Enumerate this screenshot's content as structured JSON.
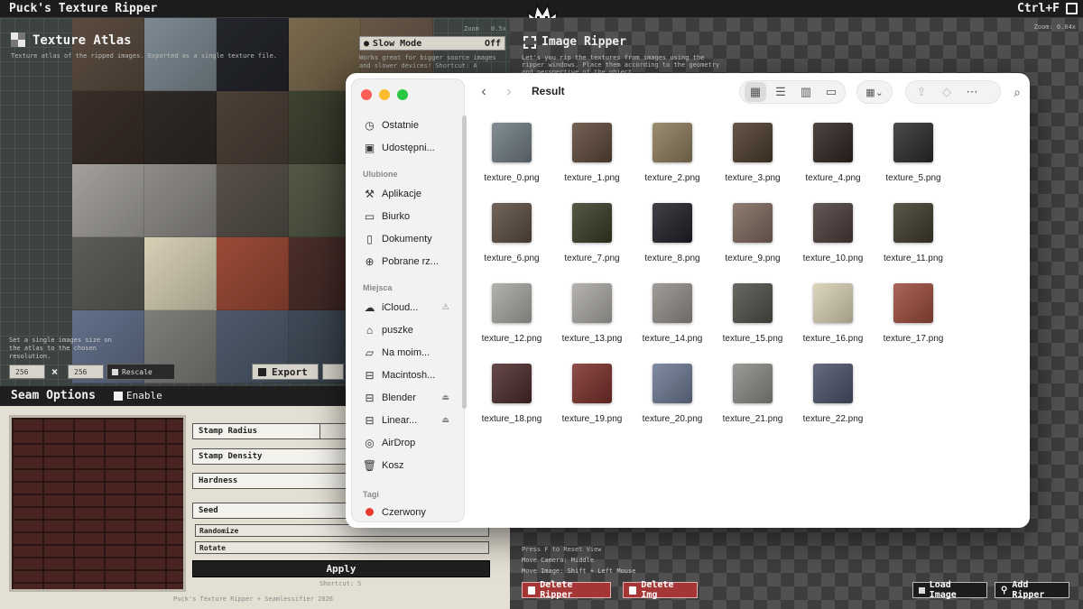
{
  "app": {
    "title": "Puck's Texture Ripper",
    "shortcut": "Ctrl+F"
  },
  "atlas": {
    "title": "Texture Atlas",
    "description": "Texture atlas of the ripped images. Exported as a single texture file.",
    "zoom_label": "Zoom",
    "zoom_value": "0.5x",
    "slow_mode_label": "Slow Mode",
    "slow_mode_value": "Off",
    "slow_mode_desc": "Works great for bigger source images and slower devices! Shortcut: A",
    "size_desc": "Set a single images size on the atlas to the chosen resolution.",
    "width": "256",
    "height": "256",
    "times": "×",
    "rescale_label": "Rescale",
    "export_label": "Export",
    "tile_colors": [
      "#5b4c40",
      "#7d8a93",
      "#23262b",
      "#7a6a4e",
      "#675848",
      "#3a2e28",
      "#2e2a27",
      "#4c4037",
      "#3e4230",
      "#3f3a2d",
      "#a4a19d",
      "#8e8b87",
      "#575049",
      "#535845",
      "#4a4235",
      "#5b5d58",
      "#d8d0b6",
      "#9b4a36",
      "#4a2e2a",
      "#4a4e56",
      "#62708a",
      "#7e7d79",
      "#4e5a6b",
      "#3f4a56",
      "#2c3038"
    ]
  },
  "seam": {
    "title": "Seam Options",
    "enable_label": "Enable",
    "stamp_radius": "Stamp Radius",
    "stamp_density": "Stamp Density",
    "hardness": "Hardness",
    "seed": "Seed",
    "randomize": "Randomize",
    "rotate": "Rotate",
    "apply": "Apply",
    "apply_shortcut": "Shortcut: S",
    "credit": "Puck's Texture Ripper + Seamlessifier 2026"
  },
  "ripper": {
    "title": "Image Ripper",
    "description": "Let's you rip the textures from images using the ripper windows. Place them according to the geometry and perspective of the object.",
    "zoom": "Zoom: 0.04x",
    "help": [
      "Press F to Reset View",
      "Move Camera: Middle",
      "Move Image: Shift + Left Mouse"
    ],
    "delete_ripper": "Delete Ripper",
    "delete_img": "Delete Img",
    "load_image": "Load Image",
    "add_ripper": "Add Ripper"
  },
  "finder": {
    "title": "Result",
    "sidebar": {
      "recent": "Ostatnie",
      "shared": "Udostępni...",
      "favorites_header": "Ulubione",
      "favorites": [
        "Aplikacje",
        "Biurko",
        "Dokumenty",
        "Pobrane rz..."
      ],
      "locations_header": "Miejsca",
      "locations": [
        "iCloud...",
        "puszke",
        "Na moim...",
        "Macintosh...",
        "Blender",
        "Linear...",
        "AirDrop",
        "Kosz"
      ],
      "tags_header": "Tagi",
      "tags": [
        "Czerwony"
      ]
    },
    "files": [
      {
        "name": "texture_0.png",
        "color": "#6d7a82"
      },
      {
        "name": "texture_1.png",
        "color": "#5b4636"
      },
      {
        "name": "texture_2.png",
        "color": "#8a7a5a"
      },
      {
        "name": "texture_3.png",
        "color": "#4a3a2a"
      },
      {
        "name": "texture_4.png",
        "color": "#2e2420"
      },
      {
        "name": "texture_5.png",
        "color": "#2c2a2a"
      },
      {
        "name": "texture_6.png",
        "color": "#5a4a3e"
      },
      {
        "name": "texture_7.png",
        "color": "#3a3a26"
      },
      {
        "name": "texture_8.png",
        "color": "#1e2026"
      },
      {
        "name": "texture_9.png",
        "color": "#7b665a"
      },
      {
        "name": "texture_10.png",
        "color": "#4a3c3a"
      },
      {
        "name": "texture_11.png",
        "color": "#3e3a2a"
      },
      {
        "name": "texture_12.png",
        "color": "#a4a4a0"
      },
      {
        "name": "texture_13.png",
        "color": "#a9a6a2"
      },
      {
        "name": "texture_14.png",
        "color": "#908c88"
      },
      {
        "name": "texture_15.png",
        "color": "#4e4e48"
      },
      {
        "name": "texture_16.png",
        "color": "#d8d0b4"
      },
      {
        "name": "texture_17.png",
        "color": "#9a4a3a"
      },
      {
        "name": "texture_18.png",
        "color": "#4a2a28"
      },
      {
        "name": "texture_19.png",
        "color": "#7a2e2a"
      },
      {
        "name": "texture_20.png",
        "color": "#6a7890"
      },
      {
        "name": "texture_21.png",
        "color": "#8a8884"
      },
      {
        "name": "texture_22.png",
        "color": "#4a5268"
      }
    ]
  }
}
